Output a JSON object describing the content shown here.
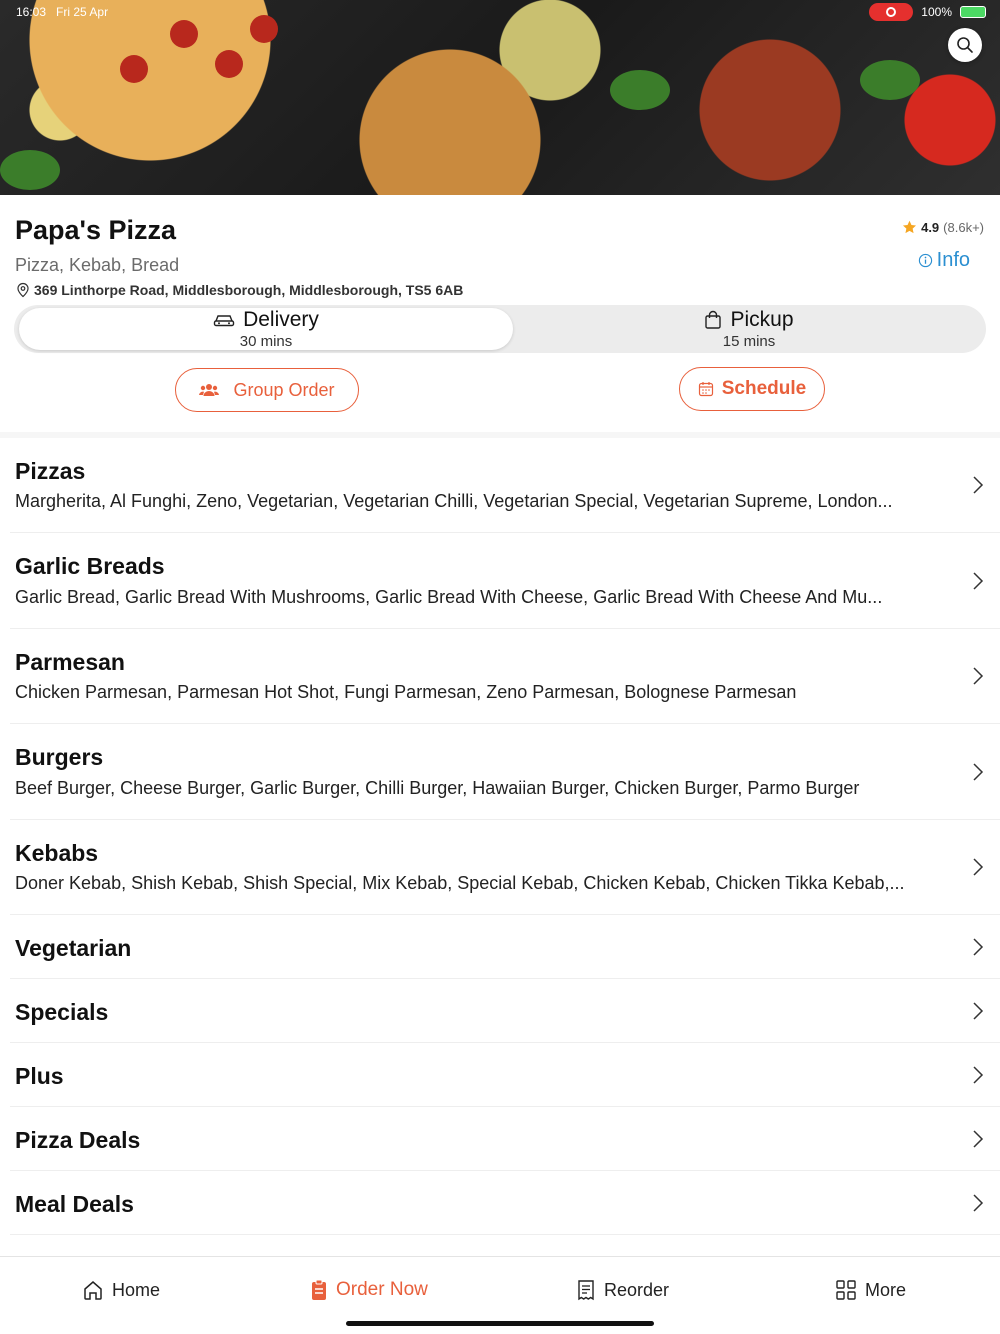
{
  "status_bar": {
    "time": "16:03",
    "date": "Fri 25 Apr",
    "battery": "100%"
  },
  "restaurant": {
    "name": "Papa's Pizza",
    "cuisine": "Pizza, Kebab, Bread",
    "address": "369 Linthorpe Road, Middlesborough, Middlesborough, TS5 6AB",
    "rating": "4.9",
    "rating_count": "(8.6k+)",
    "info_label": "Info"
  },
  "fulfilment": {
    "delivery": {
      "label": "Delivery",
      "time": "30 mins",
      "selected": true
    },
    "pickup": {
      "label": "Pickup",
      "time": "15 mins",
      "selected": false
    }
  },
  "actions": {
    "group_order": "Group Order",
    "schedule": "Schedule"
  },
  "categories": [
    {
      "title": "Pizzas",
      "items": "Margherita, Al Funghi, Zeno, Vegetarian, Vegetarian Chilli, Vegetarian Special, Vegetarian Supreme, London..."
    },
    {
      "title": "Garlic Breads",
      "items": "Garlic Bread, Garlic Bread With Mushrooms, Garlic Bread With Cheese, Garlic Bread With Cheese And Mu..."
    },
    {
      "title": "Parmesan",
      "items": "Chicken Parmesan, Parmesan Hot Shot, Fungi Parmesan, Zeno Parmesan, Bolognese Parmesan"
    },
    {
      "title": "Burgers",
      "items": "Beef Burger, Cheese Burger, Garlic Burger, Chilli Burger, Hawaiian Burger, Chicken Burger, Parmo Burger"
    },
    {
      "title": "Kebabs",
      "items": "Doner Kebab, Shish Kebab, Shish Special, Mix Kebab, Special Kebab, Chicken Kebab, Chicken Tikka Kebab,..."
    },
    {
      "title": "Vegetarian",
      "items": ""
    },
    {
      "title": "Specials",
      "items": ""
    },
    {
      "title": "Plus",
      "items": ""
    },
    {
      "title": "Pizza Deals",
      "items": ""
    },
    {
      "title": "Meal Deals",
      "items": ""
    }
  ],
  "bottom_nav": [
    {
      "label": "Home",
      "icon": "home-icon",
      "active": false
    },
    {
      "label": "Order Now",
      "icon": "order-icon",
      "active": true
    },
    {
      "label": "Reorder",
      "icon": "receipt-icon",
      "active": false
    },
    {
      "label": "More",
      "icon": "grid-icon",
      "active": false
    }
  ],
  "colors": {
    "accent": "#e8603c",
    "info": "#2b8fd1",
    "star": "#f5a623"
  }
}
